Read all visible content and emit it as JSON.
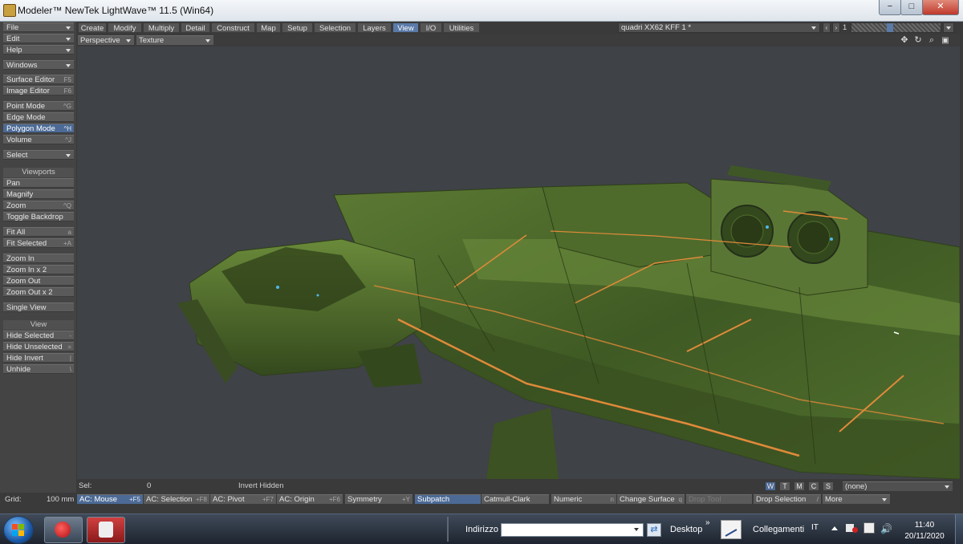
{
  "window": {
    "title": "Modeler™ NewTek LightWave™ 11.5 (Win64)"
  },
  "menu_left": [
    {
      "label": "File",
      "dropdown": true
    },
    {
      "label": "Edit",
      "dropdown": true
    },
    {
      "label": "Help",
      "dropdown": true
    }
  ],
  "windows_menu": {
    "label": "Windows"
  },
  "editors": [
    {
      "label": "Surface Editor",
      "key": "F5"
    },
    {
      "label": "Image Editor",
      "key": "F6"
    }
  ],
  "modes": [
    {
      "label": "Point Mode",
      "key": "^G",
      "selected": false
    },
    {
      "label": "Edge Mode",
      "key": "",
      "selected": false
    },
    {
      "label": "Polygon Mode",
      "key": "^H",
      "selected": true
    },
    {
      "label": "Volume",
      "key": "^J",
      "selected": false
    }
  ],
  "select_menu": {
    "label": "Select"
  },
  "viewports_header": "Viewports",
  "viewport_tools": [
    {
      "label": "Pan",
      "key": ""
    },
    {
      "label": "Magnify",
      "key": ""
    },
    {
      "label": "Zoom",
      "key": "^Q"
    },
    {
      "label": "Toggle Backdrop",
      "key": ""
    },
    {
      "label": "Fit All",
      "key": "a"
    },
    {
      "label": "Fit Selected",
      "key": "+A"
    },
    {
      "label": "Zoom In",
      "key": ""
    },
    {
      "label": "Zoom In x 2",
      "key": ""
    },
    {
      "label": "Zoom Out",
      "key": ""
    },
    {
      "label": "Zoom Out x 2",
      "key": ""
    },
    {
      "label": "Single View",
      "key": ""
    }
  ],
  "view_header": "View",
  "view_tools": [
    {
      "label": "Hide Selected",
      "key": "-"
    },
    {
      "label": "Hide Unselected",
      "key": "="
    },
    {
      "label": "Hide Invert",
      "key": "|"
    },
    {
      "label": "Unhide",
      "key": "\\"
    }
  ],
  "tabs": [
    {
      "label": "Create",
      "selected": false
    },
    {
      "label": "Modify",
      "selected": false
    },
    {
      "label": "Multiply",
      "selected": false
    },
    {
      "label": "Detail",
      "selected": false
    },
    {
      "label": "Construct",
      "selected": false
    },
    {
      "label": "Map",
      "selected": false
    },
    {
      "label": "Setup",
      "selected": false
    },
    {
      "label": "Selection",
      "selected": false
    },
    {
      "label": "Layers",
      "selected": false
    },
    {
      "label": "View",
      "selected": true
    },
    {
      "label": "I/O",
      "selected": false
    },
    {
      "label": "Utilities",
      "selected": false
    }
  ],
  "object_select": {
    "value": "quadri XX62  KFF 1 *"
  },
  "layer_number": "1",
  "viewport": {
    "view_mode": "Perspective",
    "render_mode": "Texture"
  },
  "status": {
    "sel_label": "Sel:",
    "sel_value": "0",
    "invert_hidden": "Invert Hidden",
    "wtmcs": [
      {
        "label": "W",
        "selected": true
      },
      {
        "label": "T",
        "selected": false
      },
      {
        "label": "M",
        "selected": false
      },
      {
        "label": "C",
        "selected": false
      },
      {
        "label": "S",
        "selected": false
      }
    ],
    "surface_value": "(none)"
  },
  "bottom_bar": {
    "grid_label": "Grid:",
    "grid_value": "100 mm",
    "buttons": [
      {
        "label": "AC: Mouse",
        "key": "+F5",
        "selected": true,
        "disabled": false
      },
      {
        "label": "AC: Selection",
        "key": "+F8",
        "selected": false,
        "disabled": false
      },
      {
        "label": "AC: Pivot",
        "key": "+F7",
        "selected": false,
        "disabled": false
      },
      {
        "label": "AC: Origin",
        "key": "+F6",
        "selected": false,
        "disabled": false
      },
      {
        "label": "Symmetry",
        "key": "+Y",
        "selected": false,
        "disabled": false
      },
      {
        "label": "Subpatch",
        "key": "",
        "selected": true,
        "disabled": false
      },
      {
        "label": "Catmull-Clark",
        "key": "",
        "selected": false,
        "disabled": false
      },
      {
        "label": "Numeric",
        "key": "n",
        "selected": false,
        "disabled": false
      },
      {
        "label": "Change Surface",
        "key": "q",
        "selected": false,
        "disabled": false
      },
      {
        "label": "Drop Tool",
        "key": "",
        "selected": false,
        "disabled": true
      },
      {
        "label": "Drop Selection",
        "key": "/",
        "selected": false,
        "disabled": false
      },
      {
        "label": "More",
        "key": "",
        "selected": false,
        "disabled": false
      }
    ]
  },
  "taskbar": {
    "address_label": "Indirizzo",
    "address_value": "",
    "desktop_label": "Desktop",
    "links_label": "Collegamenti",
    "lang": "IT",
    "time": "11:40",
    "date": "20/11/2020"
  },
  "colors": {
    "accent": "#4c6a95",
    "viewport_bg": "#3f4247",
    "ship_green": "#4f6b2c",
    "ship_orange": "#e08a3a"
  }
}
